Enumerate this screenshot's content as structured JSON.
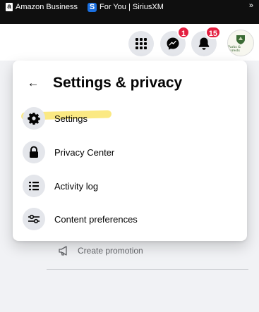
{
  "bookmarks": {
    "amazon_label": "Amazon Business",
    "sirius_label": "For You | SiriusXM",
    "more_glyph": "»"
  },
  "header": {
    "messenger_badge": "1",
    "notifications_badge": "15",
    "avatar_text": "Parks & Forests"
  },
  "menu": {
    "back_glyph": "←",
    "title": "Settings & privacy",
    "items": [
      {
        "label": "Settings",
        "icon": "gear-icon"
      },
      {
        "label": "Privacy Center",
        "icon": "lock-icon"
      },
      {
        "label": "Activity log",
        "icon": "list-icon"
      },
      {
        "label": "Content preferences",
        "icon": "sliders-icon"
      }
    ]
  },
  "background": {
    "create_promotion": "Create promotion"
  },
  "colors": {
    "badge": "#e41e3f",
    "highlight": "#fae25a",
    "icon_bg": "#e4e6eb"
  }
}
